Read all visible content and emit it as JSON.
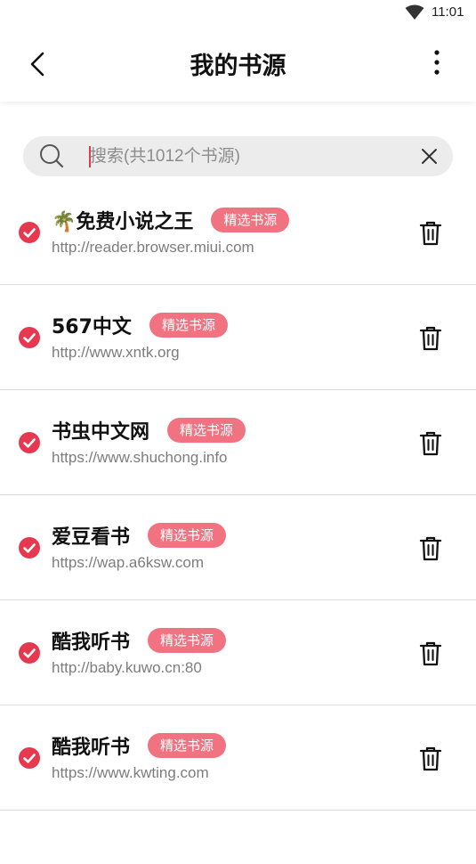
{
  "status_bar": {
    "time": "11:01"
  },
  "header": {
    "title": "我的书源"
  },
  "search": {
    "placeholder": "搜索(共1012个书源)",
    "value": ""
  },
  "accent_color": "#f17382",
  "check_color": "#e63950",
  "sources": [
    {
      "name": "🌴免费小说之王",
      "badge": "精选书源",
      "url": "http://reader.browser.miui.com",
      "selected": true
    },
    {
      "name": "567中文",
      "badge": "精选书源",
      "url": "http://www.xntk.org",
      "selected": true
    },
    {
      "name": "书虫中文网",
      "badge": "精选书源",
      "url": "https://www.shuchong.info",
      "selected": true
    },
    {
      "name": "爱豆看书",
      "badge": "精选书源",
      "url": "https://wap.a6ksw.com",
      "selected": true
    },
    {
      "name": "酷我听书",
      "badge": "精选书源",
      "url": "http://baby.kuwo.cn:80",
      "selected": true
    },
    {
      "name": "酷我听书",
      "badge": "精选书源",
      "url": "https://www.kwting.com",
      "selected": true
    }
  ]
}
